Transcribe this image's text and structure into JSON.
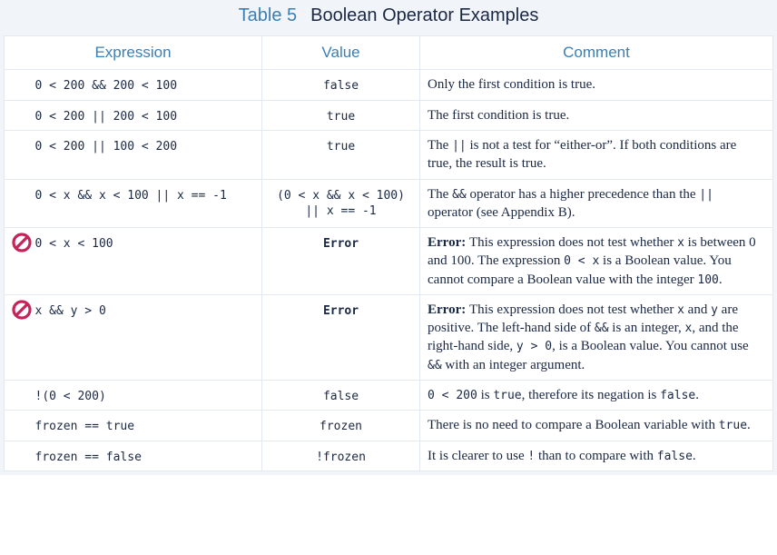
{
  "title_label": "Table 5",
  "title_text": "Boolean Operator Examples",
  "headers": {
    "expression": "Expression",
    "value": "Value",
    "comment": "Comment"
  },
  "rows": [
    {
      "error": false,
      "expr": "0 < 200 && 200 < 100",
      "value": "false",
      "comment_parts": [
        {
          "t": "Only the first condition is true."
        }
      ]
    },
    {
      "error": false,
      "expr": "0 < 200 || 200 < 100",
      "value": "true",
      "comment_parts": [
        {
          "t": "The first condition is true."
        }
      ]
    },
    {
      "error": false,
      "expr": "0 < 200 || 100 < 200",
      "value": "true",
      "comment_parts": [
        {
          "t": "The "
        },
        {
          "c": "||"
        },
        {
          "t": " is not a test for “either-or”. If both conditions are true, the result is true."
        }
      ]
    },
    {
      "error": false,
      "expr": "0 < x && x < 100 || x == -1",
      "value": "(0 < x && x < 100)\n|| x == -1",
      "comment_parts": [
        {
          "t": "The "
        },
        {
          "c": "&&"
        },
        {
          "t": " operator has a higher precedence than the "
        },
        {
          "c": "||"
        },
        {
          "t": " operator (see Appendix B)."
        }
      ]
    },
    {
      "error": true,
      "expr": "0 < x < 100",
      "value": "Error",
      "comment_parts": [
        {
          "b": "Error: "
        },
        {
          "t": "This expression does not test whether "
        },
        {
          "c": "x"
        },
        {
          "t": " is between 0 and 100. The expression "
        },
        {
          "c": "0 < x"
        },
        {
          "t": " is a Boolean value. You cannot compare a Boolean value with the integer "
        },
        {
          "c": "100"
        },
        {
          "t": "."
        }
      ]
    },
    {
      "error": true,
      "expr": "x && y > 0",
      "value": "Error",
      "comment_parts": [
        {
          "b": "Error: "
        },
        {
          "t": "This expression does not test whether "
        },
        {
          "c": "x"
        },
        {
          "t": " and "
        },
        {
          "c": "y"
        },
        {
          "t": " are positive. The left-hand side of "
        },
        {
          "c": "&&"
        },
        {
          "t": " is an integer, "
        },
        {
          "c": "x"
        },
        {
          "t": ", and the right-hand side, "
        },
        {
          "c": "y > 0"
        },
        {
          "t": ", is a Boolean value. You cannot use "
        },
        {
          "c": "&&"
        },
        {
          "t": " with an integer argument."
        }
      ]
    },
    {
      "error": false,
      "expr": "!(0 < 200)",
      "value": "false",
      "comment_parts": [
        {
          "c": "0 < 200"
        },
        {
          "t": " is "
        },
        {
          "c": "true"
        },
        {
          "t": ", therefore its negation is "
        },
        {
          "c": "false"
        },
        {
          "t": "."
        }
      ]
    },
    {
      "error": false,
      "expr": "frozen == true",
      "value": "frozen",
      "comment_parts": [
        {
          "t": "There is no need to compare a Boolean variable with "
        },
        {
          "c": "true"
        },
        {
          "t": "."
        }
      ]
    },
    {
      "error": false,
      "expr": "frozen == false",
      "value": "!frozen",
      "comment_parts": [
        {
          "t": "It is clearer to use "
        },
        {
          "c": "!"
        },
        {
          "t": " than to compare with "
        },
        {
          "c": "false"
        },
        {
          "t": "."
        }
      ]
    }
  ]
}
